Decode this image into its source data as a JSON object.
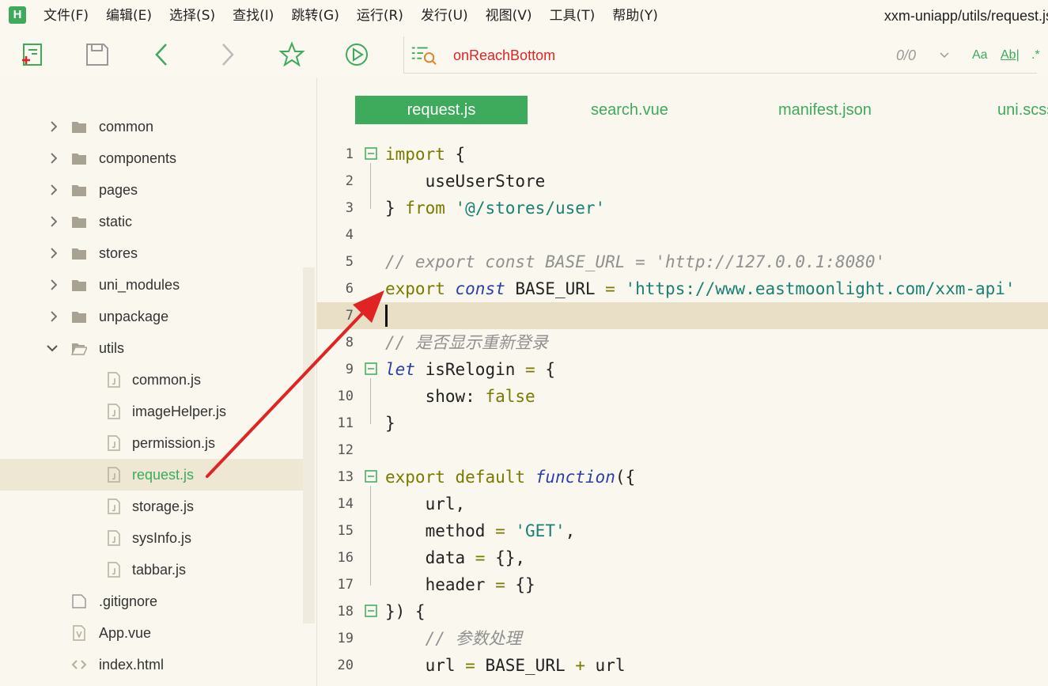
{
  "menubar": {
    "logo": "H",
    "items": [
      "文件(F)",
      "编辑(E)",
      "选择(S)",
      "查找(I)",
      "跳转(G)",
      "运行(R)",
      "发行(U)",
      "视图(V)",
      "工具(T)",
      "帮助(Y)"
    ],
    "window_title": "xxm-uniapp/utils/request.js"
  },
  "toolbar": {
    "icons": [
      "new-file-icon",
      "save-icon",
      "back-icon",
      "forward-icon",
      "star-icon",
      "run-icon",
      "goto-symbol-icon"
    ],
    "goto_text": "onReachBottom",
    "search_count": "0/0",
    "options": [
      "Aa",
      "Ab|",
      ".*"
    ]
  },
  "sidebar": {
    "folders": [
      "common",
      "components",
      "pages",
      "static",
      "stores",
      "uni_modules",
      "unpackage",
      "utils"
    ],
    "utils_files": [
      "common.js",
      "imageHelper.js",
      "permission.js",
      "request.js",
      "storage.js",
      "sysInfo.js",
      "tabbar.js"
    ],
    "root_files": [
      ".gitignore",
      "App.vue",
      "index.html"
    ],
    "selected": "request.js"
  },
  "editor": {
    "tabs": [
      "request.js",
      "search.vue",
      "manifest.json",
      "uni.scss"
    ],
    "active_tab": "request.js",
    "current_line": 7,
    "line_numbers": [
      "1",
      "2",
      "3",
      "4",
      "5",
      "6",
      "7",
      "8",
      "9",
      "10",
      "11",
      "12",
      "13",
      "14",
      "15",
      "16",
      "17",
      "18",
      "19",
      "20"
    ],
    "code": {
      "l1a": "import",
      "l1b": " {",
      "l2": "    useUserStore",
      "l3a": "} ",
      "l3b": "from",
      "l3c": " ",
      "l3d": "'@/stores/user'",
      "l5": "// export const BASE_URL = 'http://127.0.0.1:8080'",
      "l6a": "export",
      "l6b": " ",
      "l6c": "const",
      "l6d": " BASE_URL ",
      "l6e": "=",
      "l6f": " ",
      "l6g": "'https://www.eastmoonlight.com/xxm-api'",
      "l8": "// 是否显示重新登录",
      "l9a": "let",
      "l9b": " isRelogin ",
      "l9c": "=",
      "l9d": " {",
      "l10a": "    show: ",
      "l10b": "false",
      "l11": "}",
      "l13a": "export",
      "l13b": " ",
      "l13c": "default",
      "l13d": " ",
      "l13e": "function",
      "l13f": "({",
      "l14": "    url,",
      "l15a": "    method ",
      "l15b": "=",
      "l15c": " ",
      "l15d": "'GET'",
      "l15e": ",",
      "l16a": "    data ",
      "l16b": "=",
      "l16c": " {},",
      "l17a": "    header ",
      "l17b": "=",
      "l17c": " {}",
      "l18": "}) {",
      "l19": "    // 参数处理",
      "l20a": "    url ",
      "l20b": "=",
      "l20c": " BASE_URL ",
      "l20d": "+",
      "l20e": " url"
    }
  },
  "colors": {
    "accent": "#3DAA5C",
    "background": "#FAF7EE",
    "current_line": "#E8DFC6",
    "arrow": "#E02424"
  }
}
